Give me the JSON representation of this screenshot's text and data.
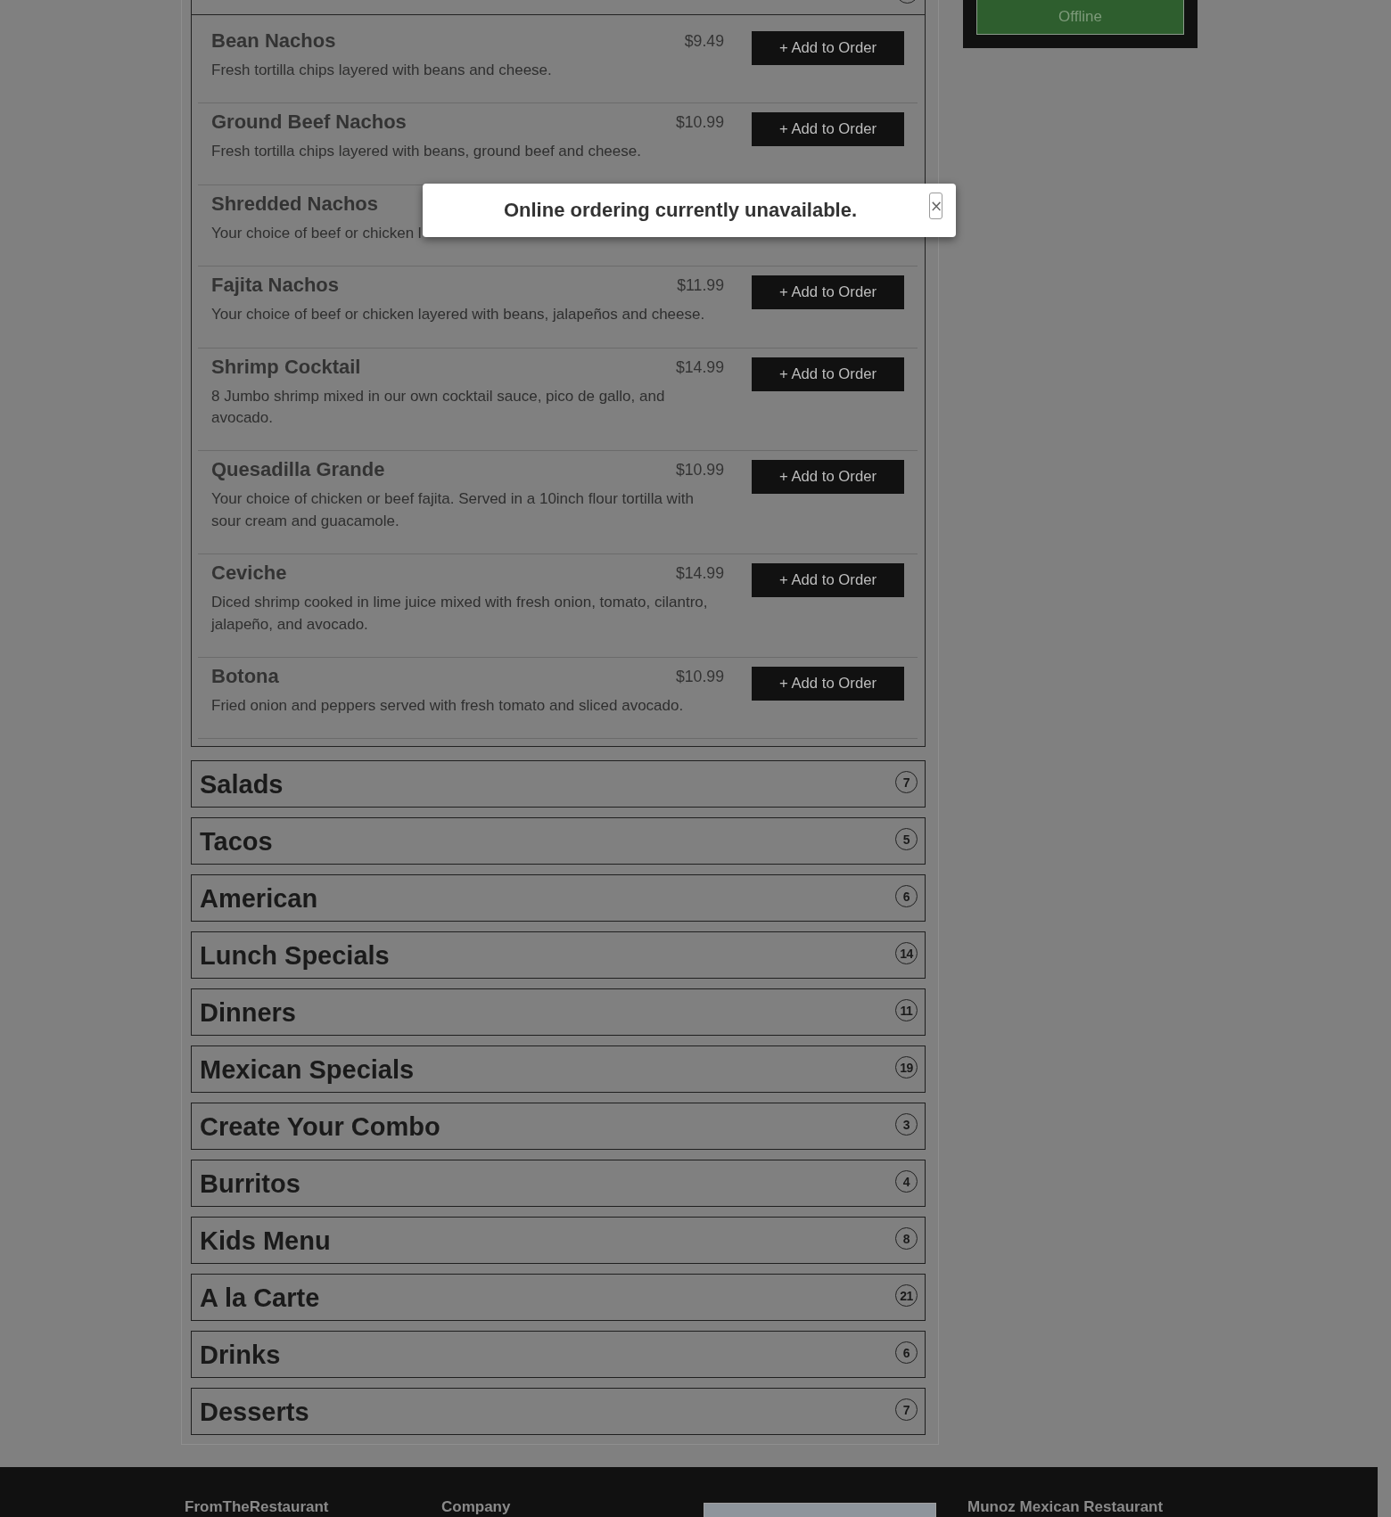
{
  "menu": {
    "open_category": {
      "items": [
        {
          "name": "Bean Nachos",
          "price": "$9.49",
          "description": "Fresh tortilla chips layered with beans and cheese.",
          "button": "+ Add to Order"
        },
        {
          "name": "Ground Beef Nachos",
          "price": "$10.99",
          "description": "Fresh tortilla chips layered with beans, ground beef and cheese.",
          "button": "+ Add to Order"
        },
        {
          "name": "Shredded Nachos",
          "description": "Your choice of beef or chicken l"
        },
        {
          "name": "Fajita Nachos",
          "price": "$11.99",
          "description": "Your choice of beef or chicken layered with beans, jalapeños and cheese.",
          "button": "+ Add to Order"
        },
        {
          "name": "Shrimp Cocktail",
          "price": "$14.99",
          "description": "8 Jumbo shrimp mixed in our own cocktail sauce, pico de gallo, and avocado.",
          "button": "+ Add to Order"
        },
        {
          "name": "Quesadilla Grande",
          "price": "$10.99",
          "description": "Your choice of chicken or beef fajita. Served in a 10inch flour tortilla with sour cream and guacamole.",
          "button": "+ Add to Order"
        },
        {
          "name": "Ceviche",
          "price": "$14.99",
          "description": "Diced shrimp cooked in lime juice mixed with fresh onion, tomato, cilantro, jalapeño, and avocado.",
          "button": "+ Add to Order"
        },
        {
          "name": "Botona",
          "price": "$10.99",
          "description": "Fried onion and peppers served with fresh tomato and sliced avocado.",
          "button": "+ Add to Order"
        }
      ]
    },
    "categories": [
      {
        "title": "Salads",
        "count": "7"
      },
      {
        "title": "Tacos",
        "count": "5"
      },
      {
        "title": "American",
        "count": "6"
      },
      {
        "title": "Lunch Specials",
        "count": "14"
      },
      {
        "title": "Dinners",
        "count": "11"
      },
      {
        "title": "Mexican Specials",
        "count": "19"
      },
      {
        "title": "Create Your Combo",
        "count": "3"
      },
      {
        "title": "Burritos",
        "count": "4"
      },
      {
        "title": "Kids Menu",
        "count": "8"
      },
      {
        "title": "A la Carte",
        "count": "21"
      },
      {
        "title": "Drinks",
        "count": "6"
      },
      {
        "title": "Desserts",
        "count": "7"
      }
    ]
  },
  "sidebar": {
    "status_button": "Offline"
  },
  "dialog": {
    "message": "Online ordering currently unavailable.",
    "close": "×"
  },
  "footer": {
    "columns": [
      {
        "kind": "heading",
        "text": "FromTheRestaurant"
      },
      {
        "kind": "heading",
        "text": "Company"
      },
      {
        "kind": "map"
      },
      {
        "kind": "heading",
        "text": "Munoz Mexican Restaurant"
      }
    ]
  }
}
